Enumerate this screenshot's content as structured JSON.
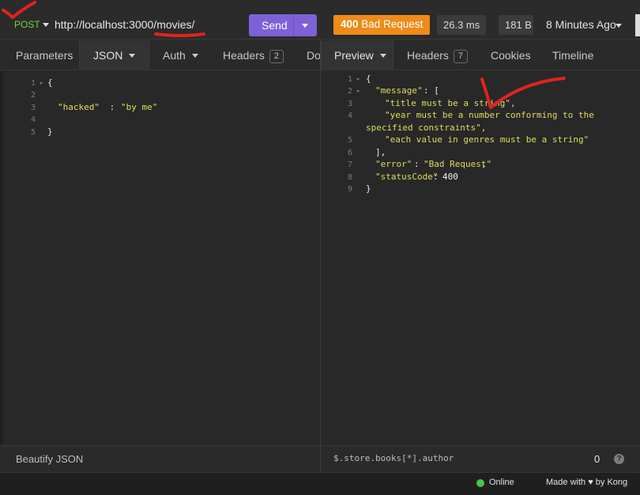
{
  "request": {
    "method": "POST",
    "url": "http://localhost:3000/movies/",
    "send_label": "Send",
    "tabs": [
      {
        "label": "Parameters"
      },
      {
        "label": "JSON"
      },
      {
        "label": "Auth"
      },
      {
        "label": "Headers",
        "count": "2"
      },
      {
        "label": "Do"
      }
    ],
    "body_lines": [
      "1",
      "2",
      "3",
      "4",
      "5"
    ],
    "body_tokens": {
      "l1_open": "{",
      "l3_key": "\"hacked\"",
      "l3_colon": " : ",
      "l3_value": "\"by me\"",
      "l5_close": "}"
    },
    "footer_label": "Beautify JSON"
  },
  "response": {
    "status_code": "400",
    "status_text": "Bad Request",
    "time": "26.3 ms",
    "size": "181 B",
    "history_label": "8 Minutes Ago",
    "tabs": [
      {
        "label": "Preview"
      },
      {
        "label": "Headers",
        "count": "7"
      },
      {
        "label": "Cookies"
      },
      {
        "label": "Timeline"
      }
    ],
    "body_lines": [
      "1",
      "2",
      "3",
      "4",
      "",
      "5",
      "6",
      "7",
      "8",
      "9"
    ],
    "body_tokens": {
      "open": "{",
      "message_key": "\"message\"",
      "message_sep": ": [",
      "msg1": "\"title must be a string\",",
      "msg2a": "\"year must be a number conforming to the",
      "msg2b": "specified constraints\",",
      "msg3": "\"each value in genres must be a string\"",
      "array_close": "],",
      "error_key": "\"error\"",
      "error_sep": ": ",
      "error_value": "\"Bad Request\"",
      "error_comma": ",",
      "status_key": "\"statusCode\"",
      "status_sep": ": ",
      "status_value": "400",
      "close": "}"
    },
    "filter_placeholder": "$.store.books[*].author",
    "filter_count": "0",
    "help": "?"
  },
  "statusbar": {
    "online_label": "Online",
    "made_with_prefix": "Made with",
    "heart": "♥",
    "made_with_suffix": "by Kong"
  },
  "colors": {
    "method": "#76d23f",
    "send": "#7e60d8",
    "status_error": "#ee8b1a",
    "json_string": "#dedc5e",
    "annotation": "#e0231f",
    "online": "#47c647"
  }
}
